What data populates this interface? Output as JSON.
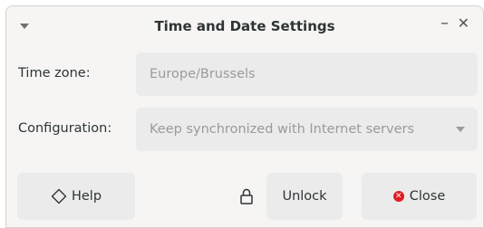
{
  "window": {
    "title": "Time and Date Settings",
    "minimize_glyph": "–",
    "close_glyph": "✕"
  },
  "form": {
    "timezone_label": "Time zone:",
    "timezone_value": "Europe/Brussels",
    "configuration_label": "Configuration:",
    "configuration_value": "Keep synchronized with Internet servers"
  },
  "buttons": {
    "help_label": "Help",
    "unlock_label": "Unlock",
    "close_label": "Close"
  },
  "icons": {
    "help": "help-diamond-icon",
    "lock": "lock-icon",
    "close": "close-circle-icon"
  },
  "colors": {
    "close_icon": "#e01b24"
  }
}
